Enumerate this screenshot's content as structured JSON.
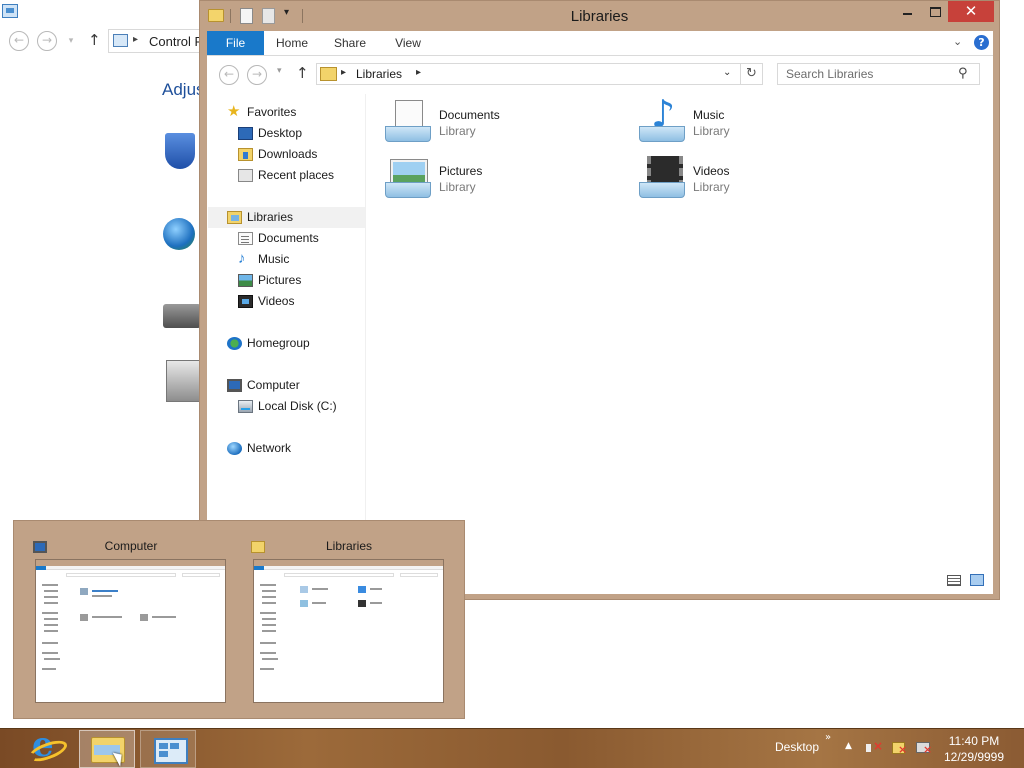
{
  "control_panel": {
    "address_text": "Control Panel",
    "heading": "Adjust your computer's settings",
    "icons": [
      "shield-icon",
      "globe-network-icon",
      "printer-icon",
      "programs-icon"
    ]
  },
  "libraries_window": {
    "title": "Libraries",
    "ribbon": {
      "file": "File",
      "home": "Home",
      "share": "Share",
      "view": "View",
      "help": "?"
    },
    "address": {
      "location": "Libraries"
    },
    "search": {
      "placeholder": "Search Libraries"
    },
    "nav": {
      "favorites": "Favorites",
      "desktop": "Desktop",
      "downloads": "Downloads",
      "recent_places": "Recent places",
      "libraries": "Libraries",
      "documents": "Documents",
      "music": "Music",
      "pictures": "Pictures",
      "videos": "Videos",
      "homegroup": "Homegroup",
      "computer": "Computer",
      "local_disk": "Local Disk (C:)",
      "network": "Network"
    },
    "items": [
      {
        "name": "Documents",
        "type": "Library",
        "icon": "documents-library-icon"
      },
      {
        "name": "Music",
        "type": "Library",
        "icon": "music-library-icon"
      },
      {
        "name": "Pictures",
        "type": "Library",
        "icon": "pictures-library-icon"
      },
      {
        "name": "Videos",
        "type": "Library",
        "icon": "videos-library-icon"
      }
    ]
  },
  "thumbnails": [
    {
      "title": "Computer",
      "icon": "computer-icon"
    },
    {
      "title": "Libraries",
      "icon": "libraries-icon"
    }
  ],
  "taskbar": {
    "desktop_label": "Desktop",
    "chevrons": "»",
    "time": "11:40 PM",
    "date": "12/29/9999",
    "pinned": [
      "internet-explorer-icon",
      "file-explorer-icon",
      "control-panel-icon"
    ]
  },
  "colors": {
    "window_frame": "#c1a287",
    "file_tab": "#1979ca",
    "close_button": "#c7413a",
    "heading_blue": "#1e4f9a"
  }
}
